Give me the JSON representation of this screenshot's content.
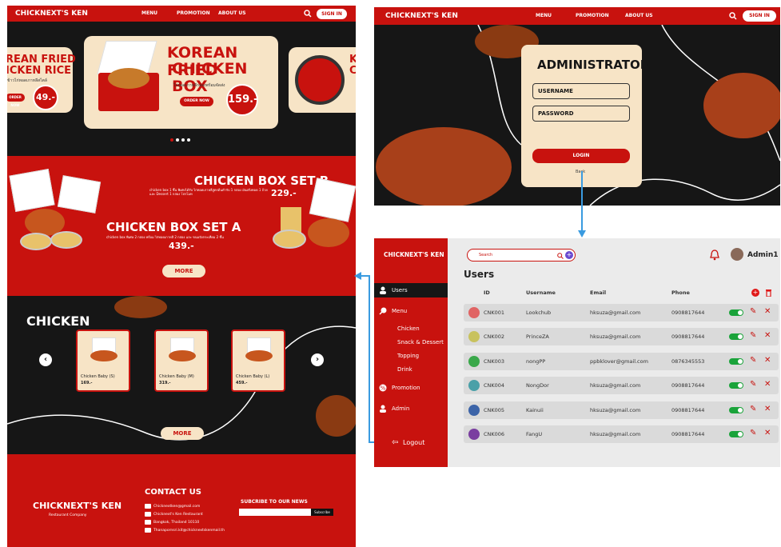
{
  "left_page": {
    "nav": {
      "brand": "CHICKNEXT'S KEN",
      "links": [
        "MENU",
        "PROMOTION",
        "ABOUT US"
      ],
      "signin": "SIGN IN"
    },
    "hero": {
      "left_title_1": "REAN FRIED",
      "left_title_2": "ICKEN RICE",
      "left_sub": "ข้าวไก่ทอดเกาหลีสไตล์",
      "left_btn": "ORDER NOW",
      "left_price": "49.-",
      "main_title_1": "KOREAN FRIED",
      "main_title_2": "CHICKEN BOX",
      "main_sub": "ไก่ทอดเกาหลีกล่องพร้อมจัดส่ง",
      "main_btn": "ORDER NOW",
      "main_price": "159.-",
      "right_title_1": "K",
      "right_title_2": "C"
    },
    "promo": {
      "set_b_title": "CHICKEN BOX SET B",
      "set_b_desc": "chicken box 1 ชิ้น พิเศษได้รับ ไก่ทอดเกาหลีสูตรต้นตำรับ 1 กล่อง มันฝรั่งทอด 1 ถ้วย และ Dessert 1 กล่อง โปรโมท",
      "set_b_price": "229.-",
      "set_a_title": "CHICKEN BOX SET A",
      "set_a_desc": "chicken box พิเศษ 2 กล่อง พร้อม ไก่ทอดเกาหลี 2 กล่อง และ ขนมปังกระเทียม 2 ชิ้น",
      "set_a_price": "439.-",
      "more": "MORE"
    },
    "chicken": {
      "title": "CHICKEN",
      "items": [
        {
          "name": "Chicken Baby (S)",
          "price": "169.-"
        },
        {
          "name": "Chicken Baby (M)",
          "price": "319.-"
        },
        {
          "name": "Chicken Baby (L)",
          "price": "459.-"
        }
      ],
      "more": "MORE"
    },
    "footer": {
      "brand": "CHICKNEXT'S KEN",
      "sub": "Restaurant Company",
      "contact_title": "CONTACT US",
      "contacts": [
        "Chicknextken@gmail.com",
        "Chicknext's Ken Restaurant",
        "Bangkok, Thailand 10110",
        "Thanapornsri.kit@chicknextskenmail.th"
      ],
      "news_title": "SUBCRIBE TO OUR NEWS",
      "subscribe_btn": "Subscribe"
    }
  },
  "login_page": {
    "nav": {
      "brand": "CHICKNEXT'S KEN",
      "links": [
        "MENU",
        "PROMOTION",
        "ABOUT US"
      ],
      "signin": "SIGN IN"
    },
    "title": "ADMINISTRATOR",
    "username_placeholder": "USERNAME",
    "password_placeholder": "PASSWORD",
    "login_btn": "LOGIN",
    "back_text": "Back"
  },
  "admin_page": {
    "brand": "CHICKNEXT'S KEN",
    "search_placeholder": "Search",
    "admin_name": "Admin1",
    "page_title": "Users",
    "sidebar": {
      "users": "Users",
      "menu": "Menu",
      "sub": [
        "Chicken",
        "Snack & Dessert",
        "Topping",
        "Drink"
      ],
      "promotion": "Promotion",
      "admin": "Admin",
      "logout": "Logout"
    },
    "columns": [
      "ID",
      "Username",
      "Email",
      "Phone"
    ],
    "rows": [
      {
        "id": "CNK001",
        "username": "Lookchub",
        "email": "hksuza@gmail.com",
        "phone": "0908817644",
        "color": "#e06464"
      },
      {
        "id": "CNK002",
        "username": "PrinceZA",
        "email": "hksuza@gmail.com",
        "phone": "0908817644",
        "color": "#c8c25e"
      },
      {
        "id": "CNK003",
        "username": "nongPP",
        "email": "ppbklover@gmail.com",
        "phone": "0876345553",
        "color": "#3aa84a"
      },
      {
        "id": "CNK004",
        "username": "NongDor",
        "email": "hksuza@gmail.com",
        "phone": "0908817644",
        "color": "#4aa0a8"
      },
      {
        "id": "CNK005",
        "username": "Kainuii",
        "email": "hksuza@gmail.com",
        "phone": "0908817644",
        "color": "#3c64a8"
      },
      {
        "id": "CNK006",
        "username": "FangU",
        "email": "hksuza@gmail.com",
        "phone": "0908817644",
        "color": "#7a3ea0"
      }
    ]
  },
  "colors": {
    "red": "#c8120e",
    "cream": "#f7e4c6",
    "dark": "#161616",
    "arrow": "#3a9be0",
    "toggle": "#1aa33a"
  }
}
